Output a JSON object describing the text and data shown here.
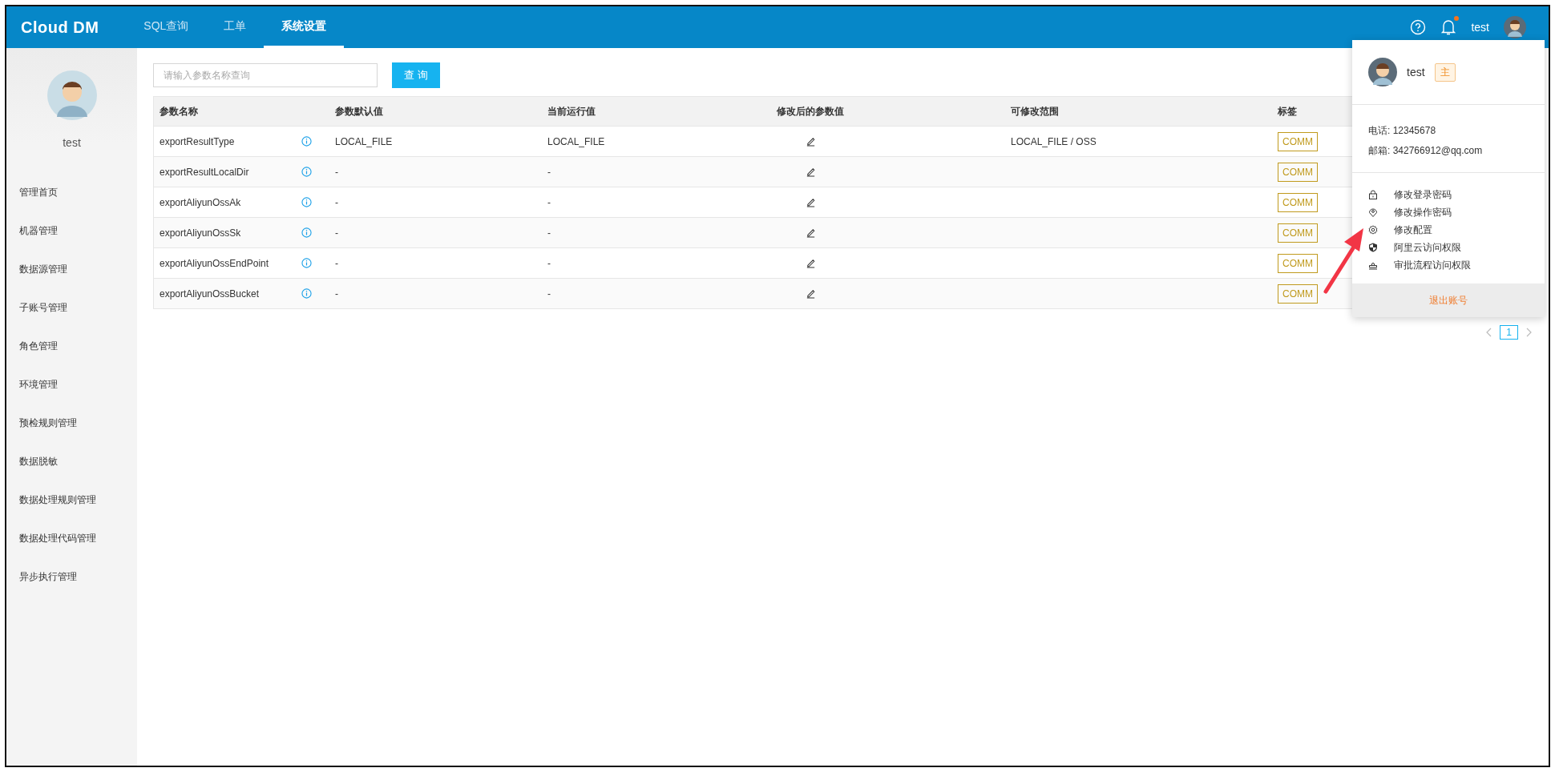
{
  "topbar": {
    "logo": "Cloud DM",
    "tabs": [
      {
        "label": "SQL查询",
        "selected": false
      },
      {
        "label": "工单",
        "selected": false
      },
      {
        "label": "系统设置",
        "selected": true
      }
    ],
    "notifications_unread": true,
    "user": "test"
  },
  "sidebar": {
    "user": "test",
    "items": [
      {
        "label": "管理首页"
      },
      {
        "label": "机器管理"
      },
      {
        "label": "数据源管理"
      },
      {
        "label": "子账号管理"
      },
      {
        "label": "角色管理"
      },
      {
        "label": "环境管理"
      },
      {
        "label": "预检规则管理"
      },
      {
        "label": "数据脱敏"
      },
      {
        "label": "数据处理规则管理"
      },
      {
        "label": "数据处理代码管理"
      },
      {
        "label": "异步执行管理"
      }
    ]
  },
  "search": {
    "placeholder": "请输入参数名称查询",
    "button": "查 询"
  },
  "table": {
    "columns": [
      "参数名称",
      "参数默认值",
      "当前运行值",
      "修改后的参数值",
      "可修改范围",
      "标签"
    ],
    "rows": [
      {
        "name": "exportResultType",
        "default": "LOCAL_FILE",
        "current": "LOCAL_FILE",
        "range": "LOCAL_FILE / OSS",
        "tag": "COMM"
      },
      {
        "name": "exportResultLocalDir",
        "default": "-",
        "current": "-",
        "tag": "COMM"
      },
      {
        "name": "exportAliyunOssAk",
        "default": "-",
        "current": "-",
        "tag": "COMM"
      },
      {
        "name": "exportAliyunOssSk",
        "default": "-",
        "current": "-",
        "tag": "COMM"
      },
      {
        "name": "exportAliyunOssEndPoint",
        "default": "-",
        "current": "-",
        "tag": "COMM"
      },
      {
        "name": "exportAliyunOssBucket",
        "default": "-",
        "current": "-",
        "tag": "COMM"
      }
    ]
  },
  "pagination": {
    "pages": [
      {
        "label": "1",
        "selected": true
      }
    ]
  },
  "user_menu": {
    "name": "test",
    "role": "主",
    "phone": "电话: 12345678",
    "email": "邮箱: 342766912@qq.com",
    "items": [
      {
        "label": "修改登录密码",
        "kind": "lock"
      },
      {
        "label": "修改操作密码",
        "kind": "key"
      },
      {
        "label": "修改配置",
        "kind": "gear"
      },
      {
        "label": "阿里云访问权限",
        "kind": "shield"
      },
      {
        "label": "审批流程访问权限",
        "kind": "stamp"
      }
    ],
    "logout": "退出账号"
  }
}
